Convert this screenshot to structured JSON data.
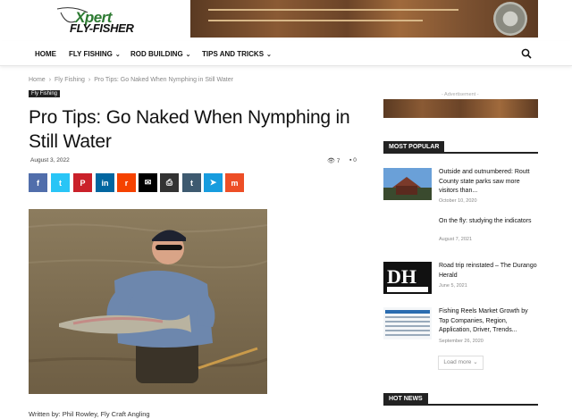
{
  "header": {
    "logo_line1": "Xpert",
    "logo_line2": "FLY-FISHER"
  },
  "nav": {
    "items": [
      {
        "label": "HOME",
        "has_dropdown": false
      },
      {
        "label": "FLY FISHING",
        "has_dropdown": true
      },
      {
        "label": "ROD BUILDING",
        "has_dropdown": true
      },
      {
        "label": "TIPS AND TRICKS",
        "has_dropdown": true
      }
    ],
    "search_icon": "search-icon"
  },
  "breadcrumb": {
    "items": [
      "Home",
      "Fly Fishing",
      "Pro Tips: Go Naked When Nymphing in Still Water"
    ]
  },
  "article": {
    "category": "Fly Fishing",
    "title": "Pro Tips: Go Naked When Nymphing in Still Water",
    "date": "August 3, 2022",
    "views": "7",
    "comments": "0",
    "byline": "Written by:  Phil Rowley, Fly Craft Angling"
  },
  "share_buttons": [
    {
      "icon": "facebook-icon",
      "glyph": "f",
      "color": "#516eab"
    },
    {
      "icon": "twitter-icon",
      "glyph": "t",
      "color": "#29c5f6"
    },
    {
      "icon": "pinterest-icon",
      "glyph": "P",
      "color": "#ca212a"
    },
    {
      "icon": "linkedin-icon",
      "glyph": "in",
      "color": "#0266a0"
    },
    {
      "icon": "reddit-icon",
      "glyph": "r",
      "color": "#f54200"
    },
    {
      "icon": "email-icon",
      "glyph": "✉",
      "color": "#000000"
    },
    {
      "icon": "print-icon",
      "glyph": "⎙",
      "color": "#333333"
    },
    {
      "icon": "tumblr-icon",
      "glyph": "t",
      "color": "#3e5a70"
    },
    {
      "icon": "telegram-icon",
      "glyph": "➤",
      "color": "#179cde"
    },
    {
      "icon": "mix-icon",
      "glyph": "m",
      "color": "#ed4e26"
    }
  ],
  "sidebar": {
    "ad_label": "- Advertisement -",
    "most_popular_label": "MOST POPULAR",
    "popular": [
      {
        "title": "Outside and outnumbered: Routt County state parks saw more visitors than...",
        "date": "October 10, 2020"
      },
      {
        "title": "On the fly: studying the indicators",
        "date": "August 7, 2021"
      },
      {
        "title": "Road trip reinstated – The Durango Herald",
        "date": "June 5, 2021"
      },
      {
        "title": "Fishing Reels Market Growth by Top Companies, Region, Application, Driver, Trends...",
        "date": "September 26, 2020"
      }
    ],
    "load_more": "Load more",
    "hot_news_label": "HOT NEWS"
  },
  "colors": {
    "accent_dark": "#222222",
    "logo_green": "#2d7a32"
  }
}
